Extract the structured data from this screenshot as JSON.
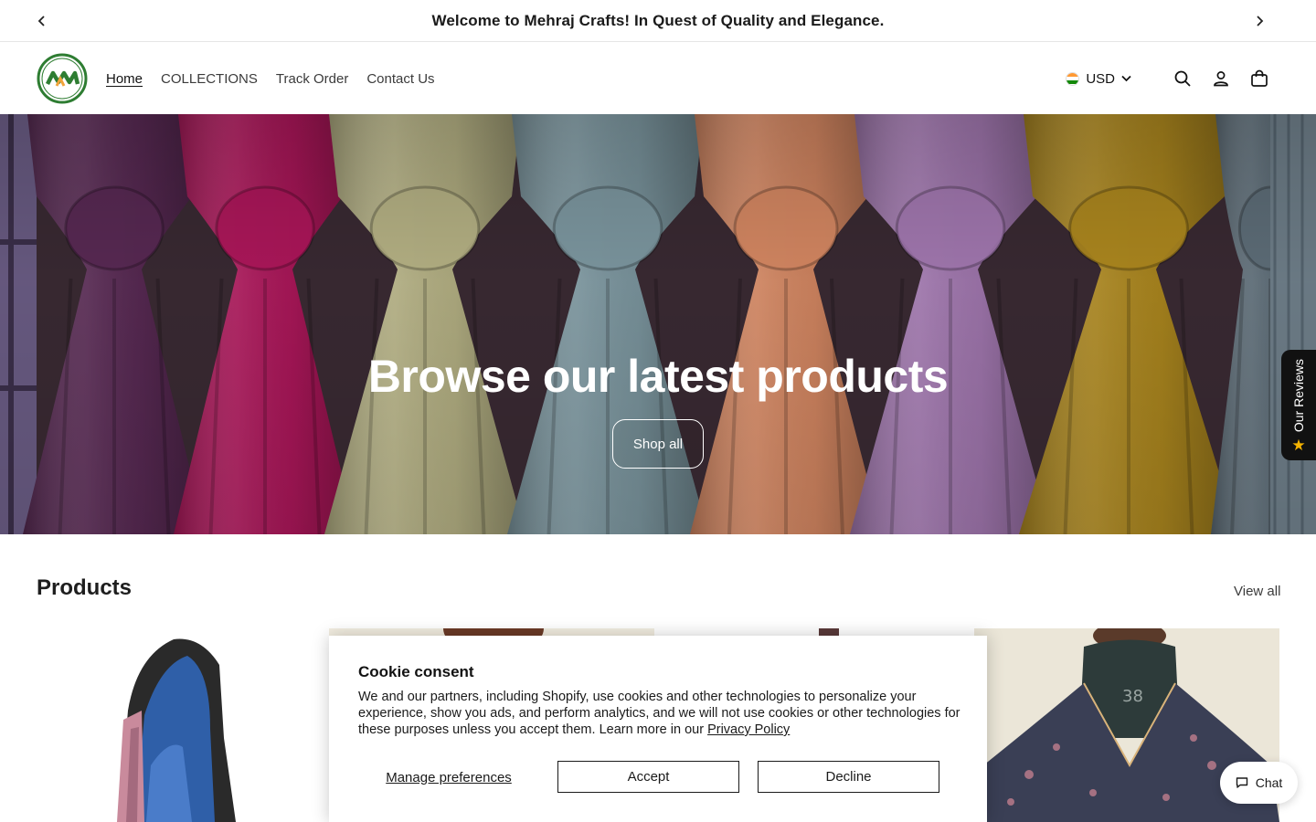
{
  "announcement": {
    "text": "Welcome to Mehraj Crafts! In Quest of Quality and Elegance.",
    "prev_icon": "chevron-left-icon",
    "next_icon": "chevron-right-icon"
  },
  "header": {
    "logo_alt": "Mehraj Crafts logo",
    "nav": [
      {
        "label": "Home",
        "active": true
      },
      {
        "label": "COLLECTIONS",
        "active": false
      },
      {
        "label": "Track Order",
        "active": false
      },
      {
        "label": "Contact Us",
        "active": false
      }
    ],
    "currency": {
      "label": "USD",
      "flag": "india-flag-icon"
    },
    "icons": [
      "search-icon",
      "account-icon",
      "cart-icon"
    ]
  },
  "hero": {
    "title": "Browse our latest products",
    "button_label": "Shop all",
    "scarf_colors": [
      "#5a2a55",
      "#b0175c",
      "#b9b587",
      "#7f9aa3",
      "#d98a64",
      "#a57ab3",
      "#b08a1f",
      "#5f6f7a"
    ]
  },
  "reviews_tab": {
    "label": "Our Reviews",
    "icon": "star-icon"
  },
  "products": {
    "title": "Products",
    "view_all_label": "View all"
  },
  "cookie": {
    "title": "Cookie consent",
    "body": "We and our partners, including Shopify, use cookies and other technologies to personalize your experience, show you ads, and perform analytics, and we will not use cookies or other technologies for these purposes unless you accept them. Learn more in our ",
    "link_label": "Privacy Policy",
    "manage_label": "Manage preferences",
    "accept_label": "Accept",
    "decline_label": "Decline"
  },
  "chat": {
    "label": "Chat",
    "icon": "chat-bubble-icon"
  },
  "colors": {
    "text": "#121212",
    "hero_text": "#ffffff",
    "reviews_bg": "#111111",
    "star": "#f5b301"
  }
}
